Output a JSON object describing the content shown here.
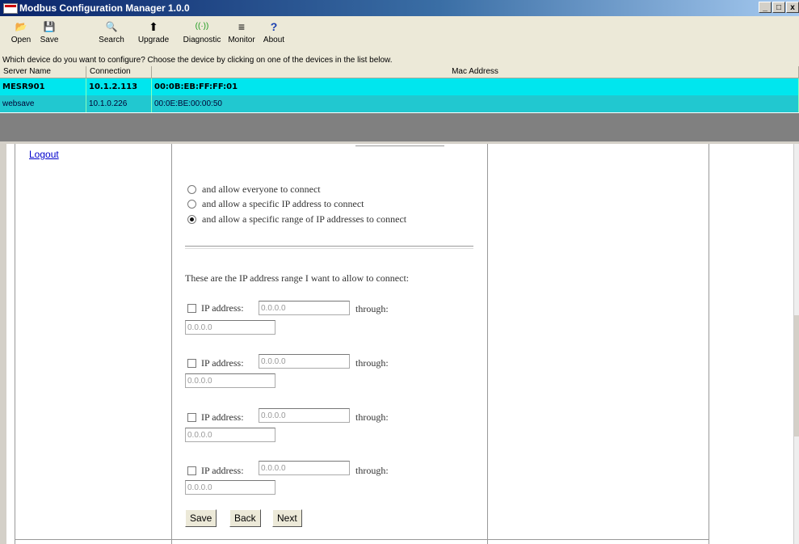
{
  "window": {
    "title": "Modbus Configuration Manager 1.0.0",
    "controls": {
      "minimize": "_",
      "maximize": "□",
      "close": "x"
    }
  },
  "toolbar": {
    "items": [
      {
        "label": "Open",
        "icon": "folder-open-icon",
        "glyph": "📂"
      },
      {
        "label": "Save",
        "icon": "floppy-disk-icon",
        "glyph": "💾"
      },
      {
        "label": "Search",
        "icon": "magnifier-icon",
        "glyph": "🔍"
      },
      {
        "label": "Upgrade",
        "icon": "upgrade-icon",
        "glyph": "⬆"
      },
      {
        "label": "Diagnostic",
        "icon": "signal-icon",
        "glyph": "((·))"
      },
      {
        "label": "Monitor",
        "icon": "document-icon",
        "glyph": "≡"
      },
      {
        "label": "About",
        "icon": "question-icon",
        "glyph": "?"
      }
    ]
  },
  "instruction": "Which device do you want to configure? Choose the device by clicking on one of the devices in the list below.",
  "devices": {
    "headers": [
      "Server Name",
      "Connection",
      "Mac Address"
    ],
    "rows": [
      {
        "name": "MESR901",
        "connection": "10.1.2.113",
        "mac": "00:0B:EB:FF:FF:01"
      },
      {
        "name": "websave",
        "connection": "10.1.0.226",
        "mac": "00:0E:BE:00:00:50"
      }
    ]
  },
  "page": {
    "logout": "Logout",
    "options": [
      {
        "label": "and allow everyone to connect",
        "checked": false
      },
      {
        "label": "and allow a specific IP address to connect",
        "checked": false
      },
      {
        "label": "and allow a specific range of IP addresses to connect",
        "checked": true
      }
    ],
    "range_heading": "These are the IP address range I want to allow to connect:",
    "ip_label": "IP address:",
    "through_label": "through:",
    "ranges": [
      {
        "from": "0.0.0.0",
        "to": "0.0.0.0"
      },
      {
        "from": "0.0.0.0",
        "to": "0.0.0.0"
      },
      {
        "from": "0.0.0.0",
        "to": "0.0.0.0"
      },
      {
        "from": "0.0.0.0",
        "to": "0.0.0.0"
      }
    ],
    "buttons": {
      "save": "Save",
      "back": "Back",
      "next": "Next"
    }
  }
}
